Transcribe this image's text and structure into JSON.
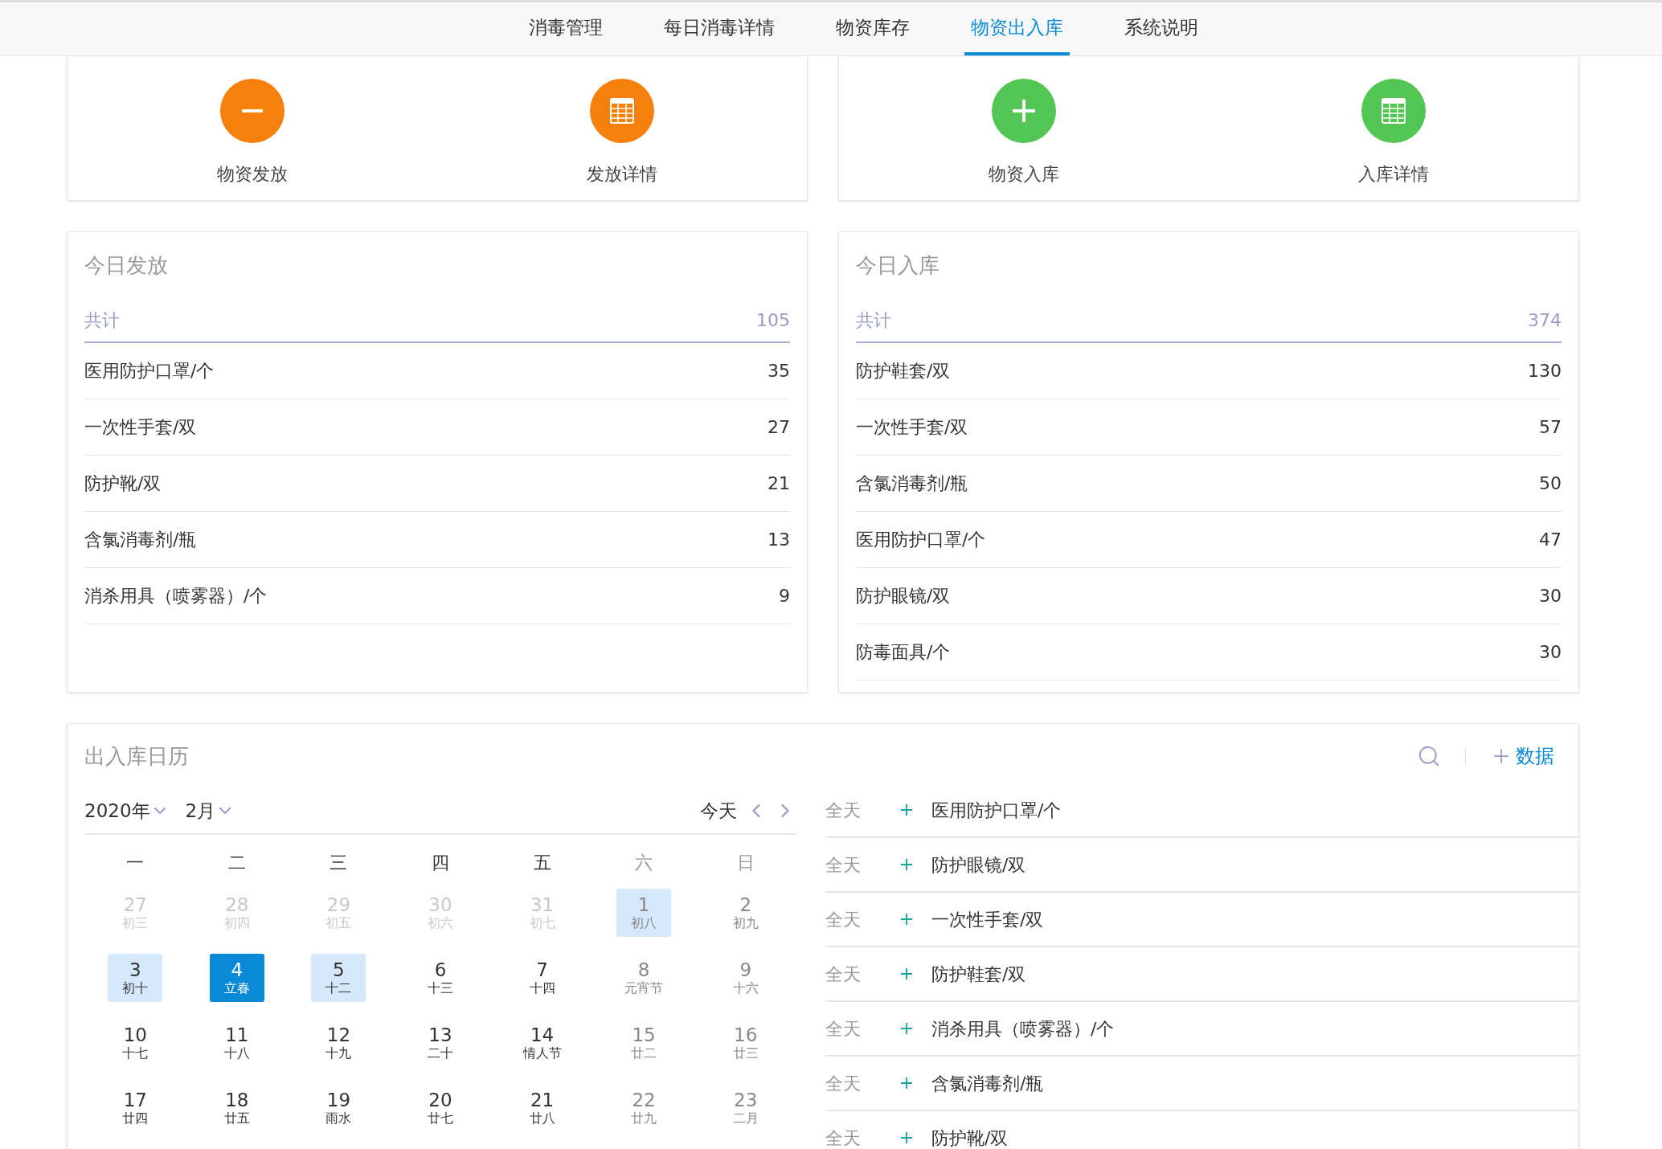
{
  "nav": {
    "tabs": [
      {
        "label": "消毒管理",
        "selected": false
      },
      {
        "label": "每日消毒详情",
        "selected": false
      },
      {
        "label": "物资库存",
        "selected": false
      },
      {
        "label": "物资出入库",
        "selected": true
      },
      {
        "label": "系统说明",
        "selected": false
      }
    ]
  },
  "action_groups": [
    {
      "actions": [
        {
          "label": "物资发放",
          "kind": "minus",
          "color": "#f77f0c"
        },
        {
          "label": "发放详情",
          "kind": "table",
          "color": "#f77f0c"
        }
      ]
    },
    {
      "actions": [
        {
          "label": "物资入库",
          "kind": "plus",
          "color": "#52c552"
        },
        {
          "label": "入库详情",
          "kind": "table",
          "color": "#52c552"
        }
      ]
    }
  ],
  "stat_cards": [
    {
      "title": "今日发放",
      "total_label": "共计",
      "total": "105",
      "rows": [
        {
          "name": "医用防护口罩/个",
          "value": "35"
        },
        {
          "name": "一次性手套/双",
          "value": "27"
        },
        {
          "name": "防护靴/双",
          "value": "21"
        },
        {
          "name": "含氯消毒剂/瓶",
          "value": "13"
        },
        {
          "name": "消杀用具（喷雾器）/个",
          "value": "9"
        }
      ]
    },
    {
      "title": "今日入库",
      "total_label": "共计",
      "total": "374",
      "rows": [
        {
          "name": "防护鞋套/双",
          "value": "130"
        },
        {
          "name": "一次性手套/双",
          "value": "57"
        },
        {
          "name": "含氯消毒剂/瓶",
          "value": "50"
        },
        {
          "name": "医用防护口罩/个",
          "value": "47"
        },
        {
          "name": "防护眼镜/双",
          "value": "30"
        },
        {
          "name": "防毒面具/个",
          "value": "30"
        }
      ]
    }
  ],
  "calendar": {
    "title": "出入库日历",
    "add_label": "数据",
    "year": "2020年",
    "month": "2月",
    "today_label": "今天",
    "weekdays": [
      {
        "label": "一",
        "muted": false
      },
      {
        "label": "二",
        "muted": false
      },
      {
        "label": "三",
        "muted": false
      },
      {
        "label": "四",
        "muted": false
      },
      {
        "label": "五",
        "muted": false
      },
      {
        "label": "六",
        "muted": true
      },
      {
        "label": "日",
        "muted": true
      }
    ],
    "weeks": [
      [
        {
          "day": "27",
          "lunar": "初三",
          "kind": "other",
          "muted": false,
          "highlighted": false,
          "selected": false
        },
        {
          "day": "28",
          "lunar": "初四",
          "kind": "other",
          "muted": false,
          "highlighted": false,
          "selected": false
        },
        {
          "day": "29",
          "lunar": "初五",
          "kind": "other",
          "muted": false,
          "highlighted": false,
          "selected": false
        },
        {
          "day": "30",
          "lunar": "初六",
          "kind": "other",
          "muted": false,
          "highlighted": false,
          "selected": false
        },
        {
          "day": "31",
          "lunar": "初七",
          "kind": "other",
          "muted": false,
          "highlighted": false,
          "selected": false
        },
        {
          "day": "1",
          "lunar": "初八",
          "kind": "current",
          "muted": true,
          "highlighted": true,
          "selected": false
        },
        {
          "day": "2",
          "lunar": "初九",
          "kind": "current",
          "muted": true,
          "highlighted": false,
          "selected": false
        }
      ],
      [
        {
          "day": "3",
          "lunar": "初十",
          "kind": "current",
          "muted": false,
          "highlighted": true,
          "selected": false
        },
        {
          "day": "4",
          "lunar": "立春",
          "kind": "current",
          "muted": false,
          "highlighted": false,
          "selected": true
        },
        {
          "day": "5",
          "lunar": "十二",
          "kind": "current",
          "muted": false,
          "highlighted": true,
          "selected": false
        },
        {
          "day": "6",
          "lunar": "十三",
          "kind": "current",
          "muted": false,
          "highlighted": false,
          "selected": false
        },
        {
          "day": "7",
          "lunar": "十四",
          "kind": "current",
          "muted": false,
          "highlighted": false,
          "selected": false
        },
        {
          "day": "8",
          "lunar": "元宵节",
          "kind": "current",
          "muted": true,
          "highlighted": false,
          "selected": false
        },
        {
          "day": "9",
          "lunar": "十六",
          "kind": "current",
          "muted": true,
          "highlighted": false,
          "selected": false
        }
      ],
      [
        {
          "day": "10",
          "lunar": "十七",
          "kind": "current",
          "muted": false,
          "highlighted": false,
          "selected": false
        },
        {
          "day": "11",
          "lunar": "十八",
          "kind": "current",
          "muted": false,
          "highlighted": false,
          "selected": false
        },
        {
          "day": "12",
          "lunar": "十九",
          "kind": "current",
          "muted": false,
          "highlighted": false,
          "selected": false
        },
        {
          "day": "13",
          "lunar": "二十",
          "kind": "current",
          "muted": false,
          "highlighted": false,
          "selected": false
        },
        {
          "day": "14",
          "lunar": "情人节",
          "kind": "current",
          "muted": false,
          "highlighted": false,
          "selected": false
        },
        {
          "day": "15",
          "lunar": "廿二",
          "kind": "current",
          "muted": true,
          "highlighted": false,
          "selected": false
        },
        {
          "day": "16",
          "lunar": "廿三",
          "kind": "current",
          "muted": true,
          "highlighted": false,
          "selected": false
        }
      ],
      [
        {
          "day": "17",
          "lunar": "廿四",
          "kind": "current",
          "muted": false,
          "highlighted": false,
          "selected": false
        },
        {
          "day": "18",
          "lunar": "廿五",
          "kind": "current",
          "muted": false,
          "highlighted": false,
          "selected": false
        },
        {
          "day": "19",
          "lunar": "雨水",
          "kind": "current",
          "muted": false,
          "highlighted": false,
          "selected": false
        },
        {
          "day": "20",
          "lunar": "廿七",
          "kind": "current",
          "muted": false,
          "highlighted": false,
          "selected": false
        },
        {
          "day": "21",
          "lunar": "廿八",
          "kind": "current",
          "muted": false,
          "highlighted": false,
          "selected": false
        },
        {
          "day": "22",
          "lunar": "廿九",
          "kind": "current",
          "muted": true,
          "highlighted": false,
          "selected": false
        },
        {
          "day": "23",
          "lunar": "二月",
          "kind": "current",
          "muted": true,
          "highlighted": false,
          "selected": false
        }
      ]
    ],
    "events": [
      {
        "time": "全天",
        "name": "医用防护口罩/个"
      },
      {
        "time": "全天",
        "name": "防护眼镜/双"
      },
      {
        "time": "全天",
        "name": "一次性手套/双"
      },
      {
        "time": "全天",
        "name": "防护鞋套/双"
      },
      {
        "time": "全天",
        "name": "消杀用具（喷雾器）/个"
      },
      {
        "time": "全天",
        "name": "含氯消毒剂/瓶"
      },
      {
        "time": "全天",
        "name": "防护靴/双"
      }
    ]
  }
}
